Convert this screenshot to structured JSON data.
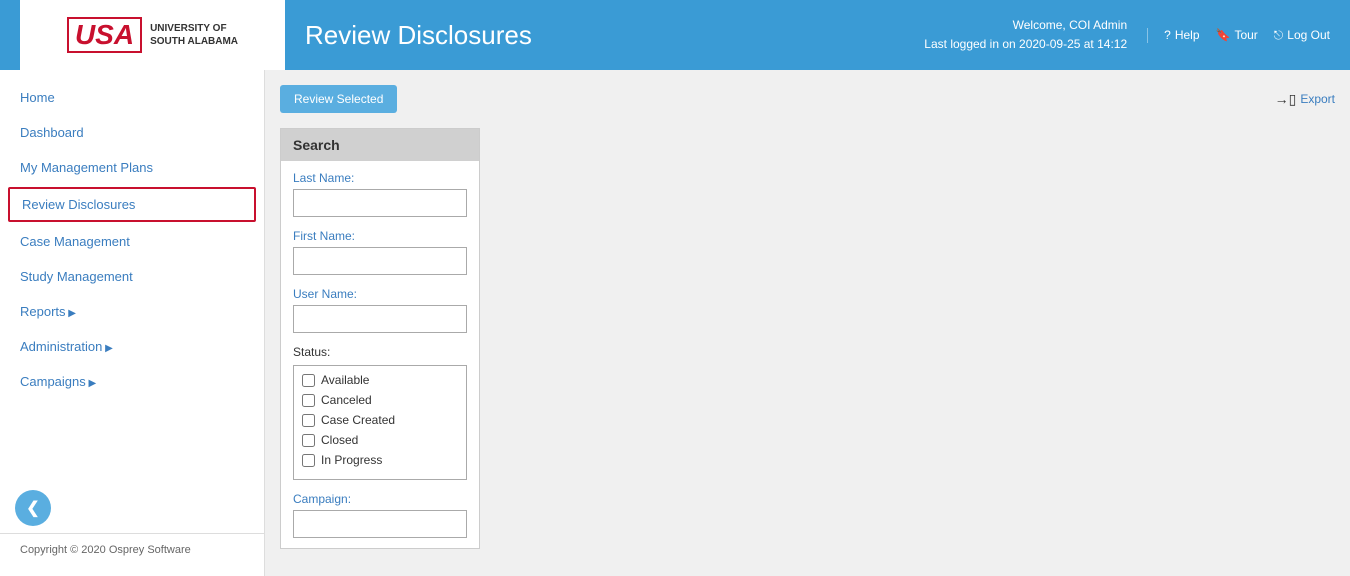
{
  "header": {
    "logo_usa": "USA",
    "logo_subtitle_line1": "UNIVERSITY OF",
    "logo_subtitle_line2": "SOUTH ALABAMA",
    "page_title": "Review Disclosures",
    "welcome_text": "Welcome, COI Admin",
    "last_logged_in": "Last logged in on 2020-09-25 at 14:12",
    "help_label": "Help",
    "tour_label": "Tour",
    "logout_label": "Log Out"
  },
  "sidebar": {
    "items": [
      {
        "id": "home",
        "label": "Home",
        "active": false,
        "has_arrow": false
      },
      {
        "id": "dashboard",
        "label": "Dashboard",
        "active": false,
        "has_arrow": false
      },
      {
        "id": "my-management-plans",
        "label": "My Management Plans",
        "active": false,
        "has_arrow": false
      },
      {
        "id": "review-disclosures",
        "label": "Review Disclosures",
        "active": true,
        "has_arrow": false
      },
      {
        "id": "case-management",
        "label": "Case Management",
        "active": false,
        "has_arrow": false
      },
      {
        "id": "study-management",
        "label": "Study Management",
        "active": false,
        "has_arrow": false
      },
      {
        "id": "reports",
        "label": "Reports",
        "active": false,
        "has_arrow": true
      },
      {
        "id": "administration",
        "label": "Administration",
        "active": false,
        "has_arrow": true
      },
      {
        "id": "campaigns",
        "label": "Campaigns",
        "active": false,
        "has_arrow": true
      }
    ],
    "copyright": "Copyright © 2020 Osprey Software",
    "toggle_icon": "❮"
  },
  "toolbar": {
    "review_selected_label": "Review Selected",
    "export_label": "Export"
  },
  "search": {
    "panel_title": "Search",
    "last_name_label": "Last Name:",
    "first_name_label": "First Name:",
    "user_name_label": "User Name:",
    "status_label": "Status:",
    "campaign_label": "Campaign:",
    "status_options": [
      {
        "id": "available",
        "label": "Available",
        "checked": false
      },
      {
        "id": "canceled",
        "label": "Canceled",
        "checked": false
      },
      {
        "id": "case-created",
        "label": "Case Created",
        "checked": false
      },
      {
        "id": "closed",
        "label": "Closed",
        "checked": false
      },
      {
        "id": "in-progress",
        "label": "In Progress",
        "checked": false
      }
    ]
  }
}
